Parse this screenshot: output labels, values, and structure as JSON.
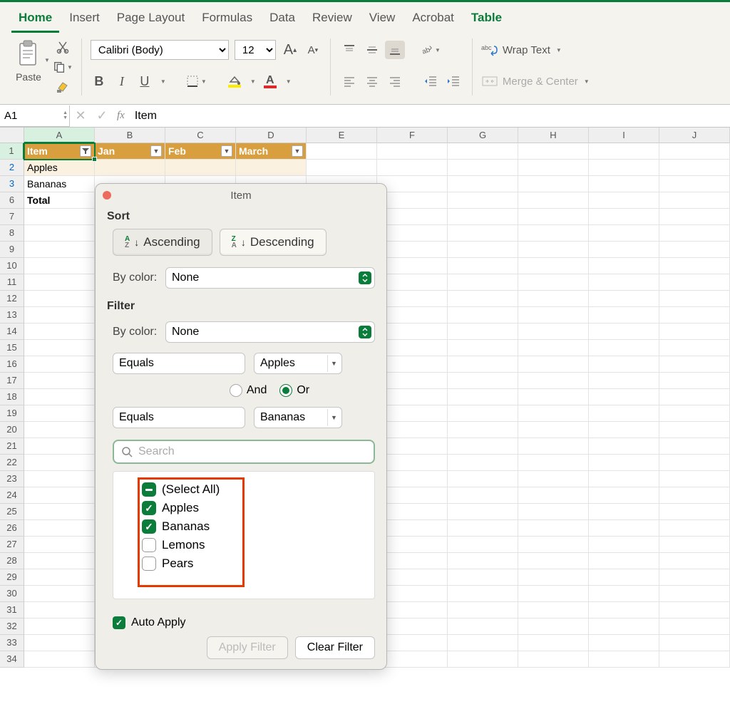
{
  "ribbon": {
    "tabs": [
      "Home",
      "Insert",
      "Page Layout",
      "Formulas",
      "Data",
      "Review",
      "View",
      "Acrobat",
      "Table"
    ],
    "active_tab": "Home",
    "paste_label": "Paste",
    "font_name": "Calibri (Body)",
    "font_size": "12",
    "wrap_text": "Wrap Text",
    "merge_center": "Merge & Center"
  },
  "formula_bar": {
    "name_box": "A1",
    "fx_label": "fx",
    "formula": "Item"
  },
  "grid": {
    "columns": [
      "A",
      "B",
      "C",
      "D",
      "E",
      "F",
      "G",
      "H",
      "I",
      "J"
    ],
    "header_row": {
      "cells": [
        "Item",
        "Jan",
        "Feb",
        "March"
      ],
      "row_num": "1"
    },
    "data_rows": [
      {
        "num": "2",
        "cells": [
          "Apples"
        ],
        "banded": true
      },
      {
        "num": "3",
        "cells": [
          "Bananas"
        ],
        "banded": false
      },
      {
        "num": "6",
        "cells": [
          "Total"
        ],
        "bold": true
      }
    ],
    "empty_row_nums": [
      "7",
      "8",
      "9",
      "10",
      "11",
      "12",
      "13",
      "14",
      "15",
      "16",
      "17",
      "18",
      "19",
      "20",
      "21",
      "22",
      "23",
      "24",
      "25",
      "26",
      "27",
      "28",
      "29",
      "30",
      "31",
      "32",
      "33",
      "34"
    ]
  },
  "popup": {
    "title": "Item",
    "sort_label": "Sort",
    "ascending": "Ascending",
    "descending": "Descending",
    "by_color_label": "By color:",
    "by_color_value": "None",
    "filter_label": "Filter",
    "filter_by_color_value": "None",
    "cond1_op": "Equals",
    "cond1_val": "Apples",
    "and_label": "And",
    "or_label": "Or",
    "logic": "or",
    "cond2_op": "Equals",
    "cond2_val": "Bananas",
    "search_placeholder": "Search",
    "items": [
      {
        "label": "(Select All)",
        "state": "mixed"
      },
      {
        "label": "Apples",
        "state": "checked"
      },
      {
        "label": "Bananas",
        "state": "checked"
      },
      {
        "label": "Lemons",
        "state": "unchecked"
      },
      {
        "label": "Pears",
        "state": "unchecked"
      }
    ],
    "auto_apply": "Auto Apply",
    "apply_filter": "Apply Filter",
    "clear_filter": "Clear Filter"
  }
}
